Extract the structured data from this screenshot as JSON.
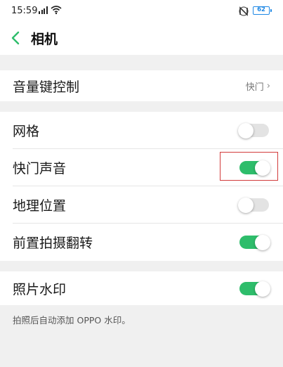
{
  "status_bar": {
    "time": "15:59",
    "battery_level": "62",
    "icons": [
      "signal-icon",
      "wifi-icon",
      "nfc-icon",
      "battery-icon"
    ]
  },
  "header": {
    "back_icon": "chevron-left-icon",
    "title": "相机"
  },
  "settings": {
    "volume_key": {
      "label": "音量键控制",
      "value": "快门",
      "chevron": "›"
    },
    "grid": {
      "label": "网格",
      "enabled": false
    },
    "shutter_sound": {
      "label": "快门声音",
      "enabled": true
    },
    "location": {
      "label": "地理位置",
      "enabled": false
    },
    "front_mirror": {
      "label": "前置拍摄翻转",
      "enabled": true
    },
    "watermark": {
      "label": "照片水印",
      "enabled": true,
      "description": "拍照后自动添加 OPPO 水印。"
    }
  },
  "colors": {
    "toggle_on": "#2ebd6b",
    "toggle_off": "#e3e3e3",
    "accent_back_arrow": "#2ebd6b",
    "highlight_border": "#d23b3b",
    "battery_blue": "#1e88e5"
  }
}
